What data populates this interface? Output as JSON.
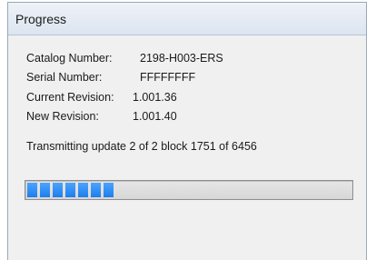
{
  "window": {
    "title": "Progress"
  },
  "info": {
    "catalog_label": "Catalog Number:",
    "catalog_value": "2198-H003-ERS",
    "serial_label": "Serial Number:",
    "serial_value": "FFFFFFFF",
    "current_rev_label": "Current Revision:",
    "current_rev_value": "1.001.36",
    "new_rev_label": "New Revision:",
    "new_rev_value": "1.001.40"
  },
  "status": {
    "message": "Transmitting update 2 of 2  block 1751 of 6456"
  },
  "progress": {
    "fraction": 0.27,
    "color": "#2a8cf0"
  }
}
